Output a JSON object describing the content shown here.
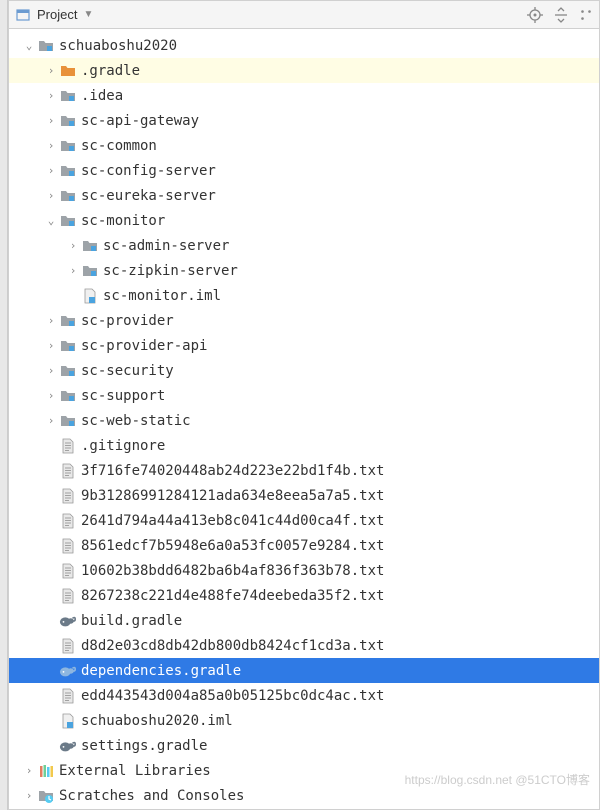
{
  "header": {
    "title": "Project"
  },
  "tree": [
    {
      "depth": 0,
      "arrow": "down",
      "icon": "folder-module",
      "label": "schuaboshu2020",
      "state": ""
    },
    {
      "depth": 1,
      "arrow": "right",
      "icon": "folder-orange",
      "label": ".gradle",
      "state": "highlighted"
    },
    {
      "depth": 1,
      "arrow": "right",
      "icon": "folder-module",
      "label": ".idea",
      "state": ""
    },
    {
      "depth": 1,
      "arrow": "right",
      "icon": "folder-module",
      "label": "sc-api-gateway",
      "state": ""
    },
    {
      "depth": 1,
      "arrow": "right",
      "icon": "folder-module",
      "label": "sc-common",
      "state": ""
    },
    {
      "depth": 1,
      "arrow": "right",
      "icon": "folder-module",
      "label": "sc-config-server",
      "state": ""
    },
    {
      "depth": 1,
      "arrow": "right",
      "icon": "folder-module",
      "label": "sc-eureka-server",
      "state": ""
    },
    {
      "depth": 1,
      "arrow": "down",
      "icon": "folder-module",
      "label": "sc-monitor",
      "state": ""
    },
    {
      "depth": 2,
      "arrow": "right",
      "icon": "folder-module",
      "label": "sc-admin-server",
      "state": ""
    },
    {
      "depth": 2,
      "arrow": "right",
      "icon": "folder-module",
      "label": "sc-zipkin-server",
      "state": ""
    },
    {
      "depth": 2,
      "arrow": "",
      "icon": "iml-file",
      "label": "sc-monitor.iml",
      "state": ""
    },
    {
      "depth": 1,
      "arrow": "right",
      "icon": "folder-module",
      "label": "sc-provider",
      "state": ""
    },
    {
      "depth": 1,
      "arrow": "right",
      "icon": "folder-module",
      "label": "sc-provider-api",
      "state": ""
    },
    {
      "depth": 1,
      "arrow": "right",
      "icon": "folder-module",
      "label": "sc-security",
      "state": ""
    },
    {
      "depth": 1,
      "arrow": "right",
      "icon": "folder-module",
      "label": "sc-support",
      "state": ""
    },
    {
      "depth": 1,
      "arrow": "right",
      "icon": "folder-module",
      "label": "sc-web-static",
      "state": ""
    },
    {
      "depth": 1,
      "arrow": "",
      "icon": "text-file",
      "label": ".gitignore",
      "state": ""
    },
    {
      "depth": 1,
      "arrow": "",
      "icon": "text-file",
      "label": "3f716fe74020448ab24d223e22bd1f4b.txt",
      "state": ""
    },
    {
      "depth": 1,
      "arrow": "",
      "icon": "text-file",
      "label": "9b31286991284121ada634e8eea5a7a5.txt",
      "state": ""
    },
    {
      "depth": 1,
      "arrow": "",
      "icon": "text-file",
      "label": "2641d794a44a413eb8c041c44d00ca4f.txt",
      "state": ""
    },
    {
      "depth": 1,
      "arrow": "",
      "icon": "text-file",
      "label": "8561edcf7b5948e6a0a53fc0057e9284.txt",
      "state": ""
    },
    {
      "depth": 1,
      "arrow": "",
      "icon": "text-file",
      "label": "10602b38bdd6482ba6b4af836f363b78.txt",
      "state": ""
    },
    {
      "depth": 1,
      "arrow": "",
      "icon": "text-file",
      "label": "8267238c221d4e488fe74deebeda35f2.txt",
      "state": ""
    },
    {
      "depth": 1,
      "arrow": "",
      "icon": "gradle-file",
      "label": "build.gradle",
      "state": ""
    },
    {
      "depth": 1,
      "arrow": "",
      "icon": "text-file",
      "label": "d8d2e03cd8db42db800db8424cf1cd3a.txt",
      "state": ""
    },
    {
      "depth": 1,
      "arrow": "",
      "icon": "gradle-file",
      "label": "dependencies.gradle",
      "state": "selected"
    },
    {
      "depth": 1,
      "arrow": "",
      "icon": "text-file",
      "label": "edd443543d004a85a0b05125bc0dc4ac.txt",
      "state": ""
    },
    {
      "depth": 1,
      "arrow": "",
      "icon": "iml-file",
      "label": "schuaboshu2020.iml",
      "state": ""
    },
    {
      "depth": 1,
      "arrow": "",
      "icon": "gradle-file",
      "label": "settings.gradle",
      "state": ""
    },
    {
      "depth": 0,
      "arrow": "right",
      "icon": "libraries",
      "label": "External Libraries",
      "state": ""
    },
    {
      "depth": 0,
      "arrow": "right",
      "icon": "scratches",
      "label": "Scratches and Consoles",
      "state": ""
    }
  ],
  "watermark": "https://blog.csdn.net @51CTO博客"
}
